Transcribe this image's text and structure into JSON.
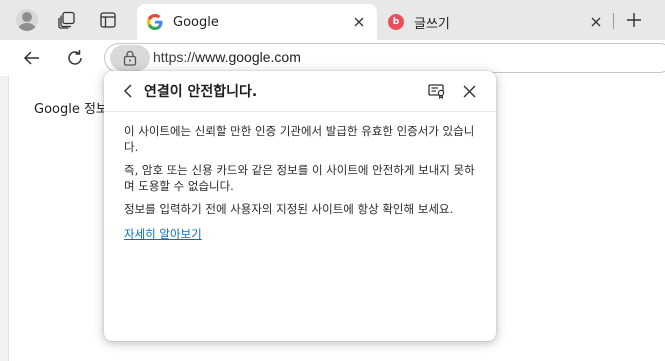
{
  "tabs": [
    {
      "title": "Google",
      "favicon": "google-icon"
    },
    {
      "title": "글쓰기",
      "favicon": "brunch-icon"
    }
  ],
  "toolbar": {
    "url_scheme": "https://",
    "url_host": "www.google.com"
  },
  "page": {
    "visible_text": "Google 정보"
  },
  "flyout": {
    "title": "연결이 안전합니다.",
    "paragraphs": [
      "이 사이트에는 신뢰할 만한 인증 기관에서 발급한 유효한 인증서가 있습니다.",
      "즉, 암호 또는 신용 카드와 같은 정보를 이 사이트에 안전하게 보내지 못하며 도용할 수 없습니다.",
      "정보를 입력하기 전에 사용자의 지정된 사이트에 항상 확인해 보세요."
    ],
    "learn_more": "자세히 알아보기"
  },
  "colors": {
    "link": "#0f6cbd",
    "tabstrip_bg": "#e8e8e8",
    "lock_pill_bg": "#d9d9d9"
  }
}
